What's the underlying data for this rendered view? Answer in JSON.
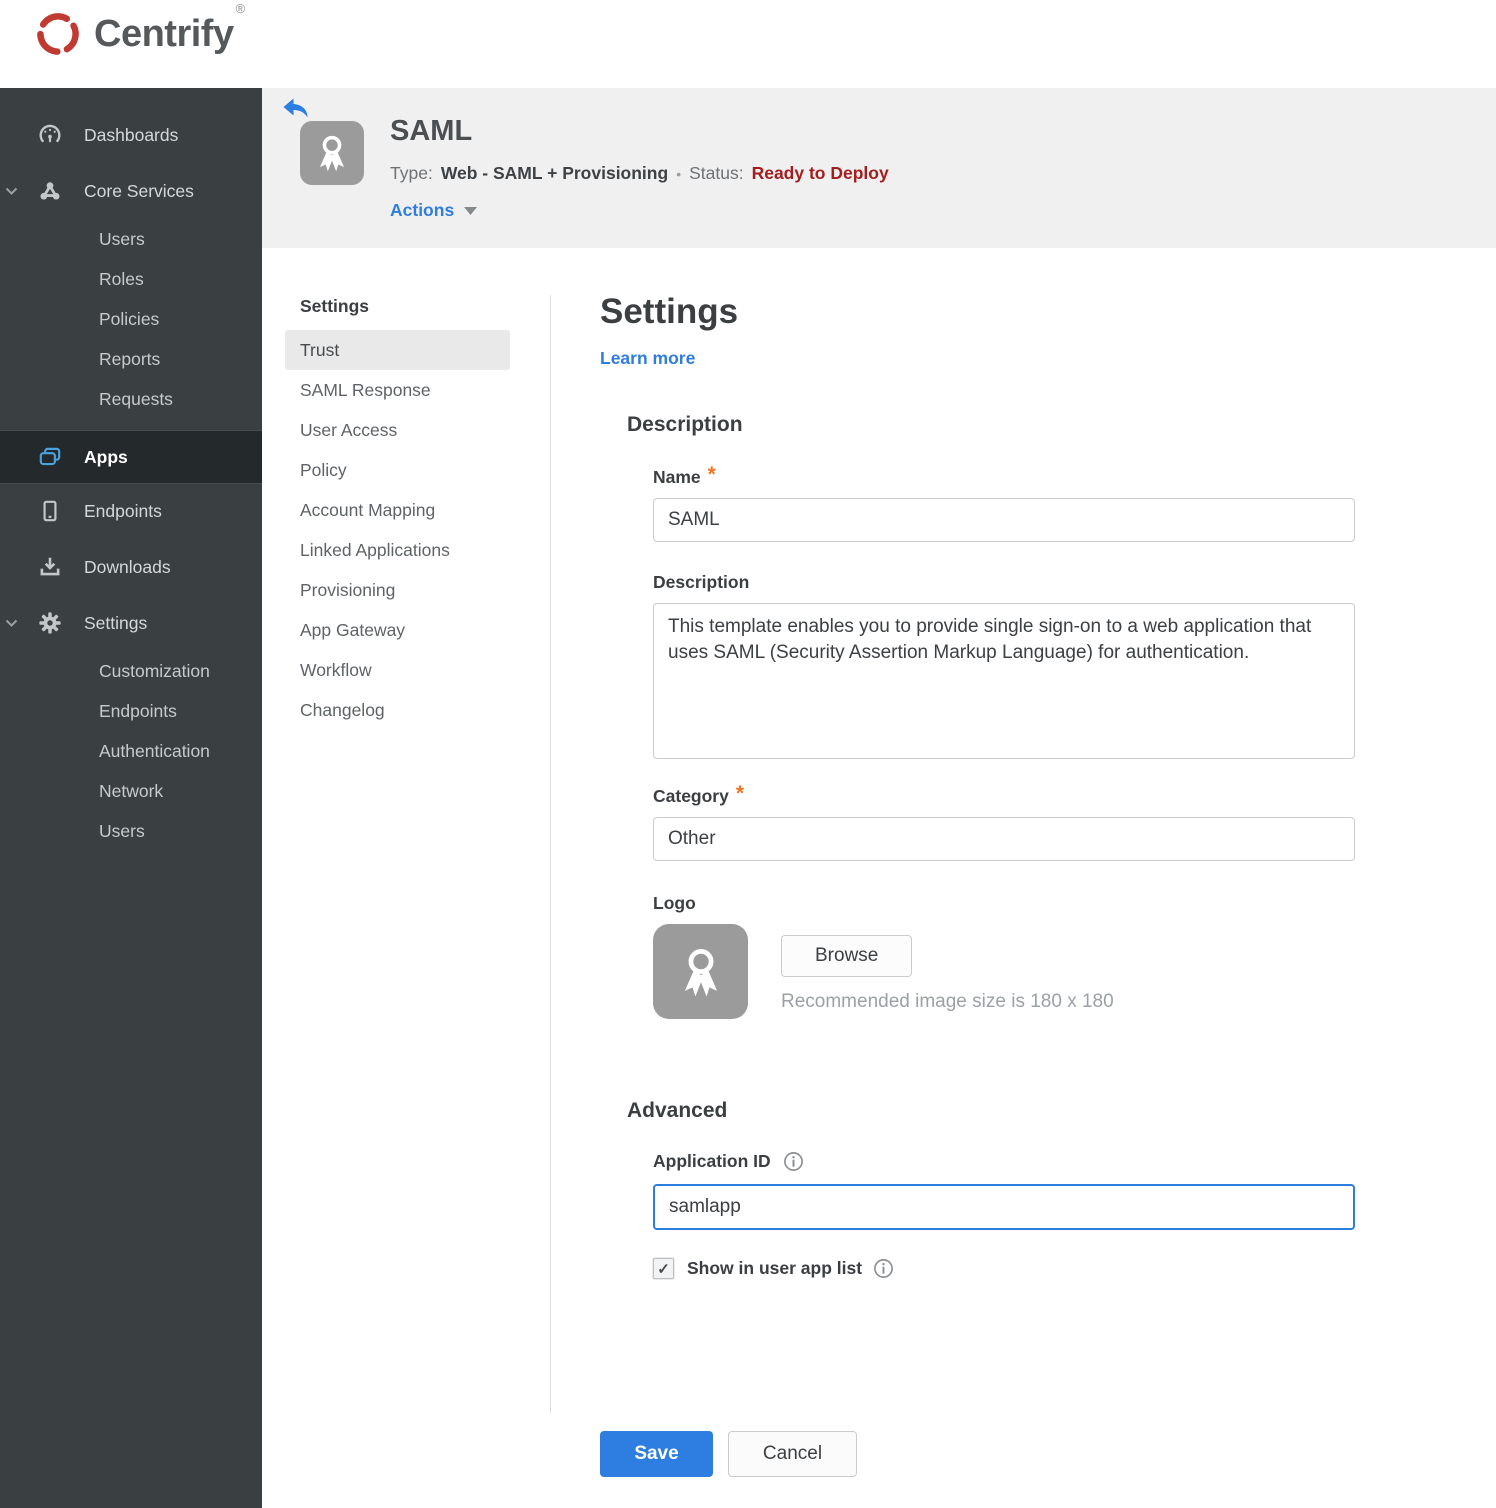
{
  "brand": {
    "name": "Centrify",
    "mark": "®"
  },
  "sidebar": {
    "dashboards": "Dashboards",
    "core_services": {
      "label": "Core Services",
      "children": [
        "Users",
        "Roles",
        "Policies",
        "Reports",
        "Requests"
      ]
    },
    "apps": "Apps",
    "endpoints": "Endpoints",
    "downloads": "Downloads",
    "settings": {
      "label": "Settings",
      "children": [
        "Customization",
        "Endpoints",
        "Authentication",
        "Network",
        "Users"
      ]
    }
  },
  "app_header": {
    "title": "SAML",
    "type_label": "Type:",
    "type_value": "Web - SAML + Provisioning",
    "separator": "•",
    "status_label": "Status:",
    "status_value": "Ready to Deploy",
    "actions": "Actions"
  },
  "subnav": {
    "header": "Settings",
    "active_item": "Trust",
    "items": [
      "Trust",
      "SAML Response",
      "User Access",
      "Policy",
      "Account Mapping",
      "Linked Applications",
      "Provisioning",
      "App Gateway",
      "Workflow",
      "Changelog"
    ]
  },
  "main": {
    "title": "Settings",
    "learn_more": "Learn more",
    "required_marker": "*",
    "description_section": {
      "heading": "Description",
      "name_label": "Name",
      "name_value": "SAML",
      "description_label": "Description",
      "description_value": "This template enables you to provide single sign-on to a web application that uses SAML (Security Assertion Markup Language) for authentication.",
      "category_label": "Category",
      "category_value": "Other",
      "logo_label": "Logo",
      "browse_button": "Browse",
      "recommended_text": "Recommended image size is 180 x 180"
    },
    "advanced_section": {
      "heading": "Advanced",
      "application_id_label": "Application ID",
      "application_id_value": "samlapp",
      "show_in_user_app_list_label": "Show in user app list",
      "checkbox_checked": true,
      "checkbox_glyph": "✓"
    },
    "buttons": {
      "save": "Save",
      "cancel": "Cancel"
    }
  },
  "icons": {
    "brand": "centrify-swirl-icon",
    "dashboards": "gauge-icon",
    "core_services": "nodes-icon",
    "apps": "overlapping-windows-icon",
    "endpoints": "mobile-device-icon",
    "downloads": "download-icon",
    "settings": "gear-icon",
    "back": "back-arrow-icon",
    "app_logo": "award-ribbon-icon",
    "caret": "caret-down-icon",
    "info": "info-icon"
  },
  "colors": {
    "accent_blue": "#2e7de0",
    "status_red": "#a31e1e",
    "required_orange": "#ee7623",
    "apps_icon_blue": "#4aa3dc",
    "sidebar_bg": "#3a3f41",
    "header_gray": "#f0f0f1"
  }
}
